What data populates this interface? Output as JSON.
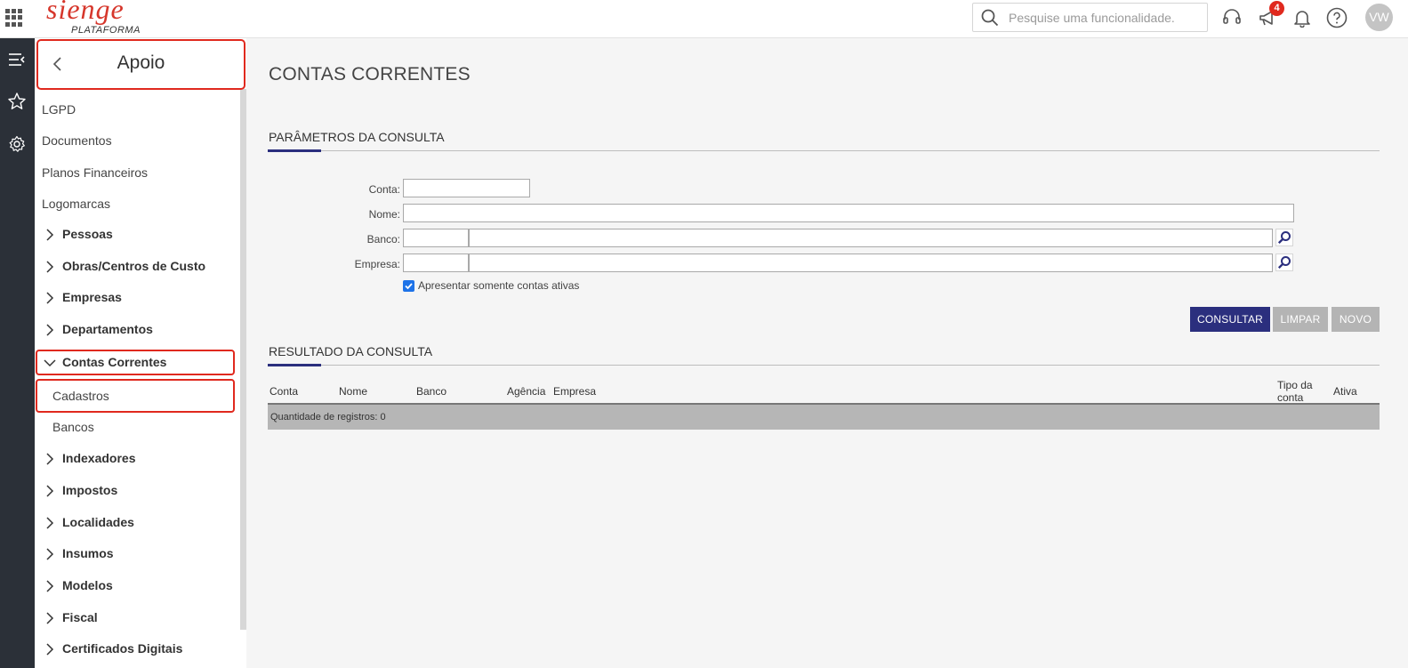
{
  "app": {
    "logo_text": "sienge",
    "logo_sub": "PLATAFORMA"
  },
  "header": {
    "search_placeholder": "Pesquise uma funcionalidade.",
    "notification_count": "4",
    "user_initials": "VW"
  },
  "sidebar": {
    "title": "Apoio",
    "items": [
      {
        "label": "LGPD"
      },
      {
        "label": "Documentos"
      },
      {
        "label": "Planos Financeiros"
      },
      {
        "label": "Logomarcas"
      }
    ],
    "groups": [
      {
        "label": "Pessoas",
        "expanded": false
      },
      {
        "label": "Obras/Centros de Custo",
        "expanded": false
      },
      {
        "label": "Empresas",
        "expanded": false
      },
      {
        "label": "Departamentos",
        "expanded": false
      },
      {
        "label": "Contas Correntes",
        "expanded": true,
        "children": [
          {
            "label": "Cadastros"
          },
          {
            "label": "Bancos"
          }
        ]
      },
      {
        "label": "Indexadores",
        "expanded": false
      },
      {
        "label": "Impostos",
        "expanded": false
      },
      {
        "label": "Localidades",
        "expanded": false
      },
      {
        "label": "Insumos",
        "expanded": false
      },
      {
        "label": "Modelos",
        "expanded": false
      },
      {
        "label": "Fiscal",
        "expanded": false
      },
      {
        "label": "Certificados Digitais",
        "expanded": false
      }
    ]
  },
  "main": {
    "page_title": "CONTAS CORRENTES",
    "params_section": "PARÂMETROS DA CONSULTA",
    "form": {
      "conta_label": "Conta:",
      "conta_value": "",
      "nome_label": "Nome:",
      "nome_value": "",
      "banco_label": "Banco:",
      "banco_code": "",
      "banco_name": "",
      "empresa_label": "Empresa:",
      "empresa_code": "",
      "empresa_name": "",
      "only_active_label": "Apresentar somente contas ativas",
      "only_active_checked": true
    },
    "buttons": {
      "consultar": "CONSULTAR",
      "limpar": "LIMPAR",
      "novo": "NOVO"
    },
    "result_section": "RESULTADO DA CONSULTA",
    "table": {
      "columns": [
        "Conta",
        "Nome",
        "Banco",
        "Agência",
        "Empresa",
        "Tipo da conta",
        "Ativa"
      ],
      "footer": "Quantidade de registros: 0"
    }
  },
  "colors": {
    "accent": "#2b2f7e",
    "brand_red": "#d6362b",
    "highlight": "#e0291e",
    "dark_strip": "#2b3038"
  }
}
